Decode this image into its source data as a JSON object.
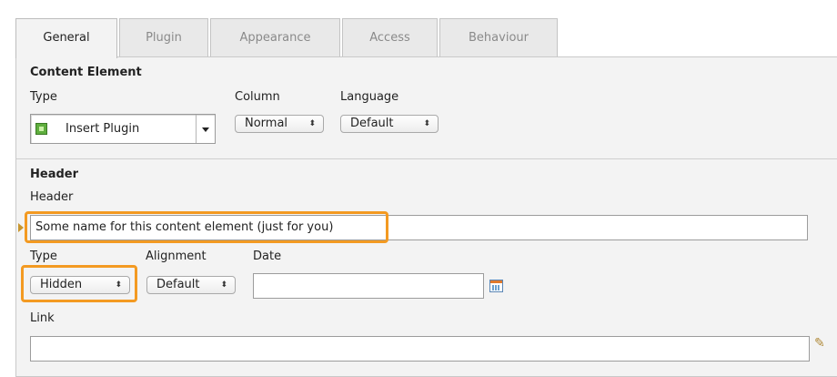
{
  "tabs": [
    {
      "label": "General",
      "active": true
    },
    {
      "label": "Plugin",
      "active": false
    },
    {
      "label": "Appearance",
      "active": false
    },
    {
      "label": "Access",
      "active": false
    },
    {
      "label": "Behaviour",
      "active": false
    }
  ],
  "content_element": {
    "heading": "Content Element",
    "type_label": "Type",
    "type_value": "Insert Plugin",
    "type_icon": "plugin-icon",
    "column_label": "Column",
    "column_value": "Normal",
    "language_label": "Language",
    "language_value": "Default"
  },
  "header_section": {
    "heading": "Header",
    "header_label": "Header",
    "header_value": "Some name for this content element (just for you)",
    "type_label": "Type",
    "type_value": "Hidden",
    "alignment_label": "Alignment",
    "alignment_value": "Default",
    "date_label": "Date",
    "date_value": "",
    "link_label": "Link",
    "link_value": ""
  },
  "highlight_color": "#f39a22",
  "icons": {
    "calendar": "calendar-icon",
    "link": "link-wizard-icon",
    "chevron": "⌃⌄"
  }
}
